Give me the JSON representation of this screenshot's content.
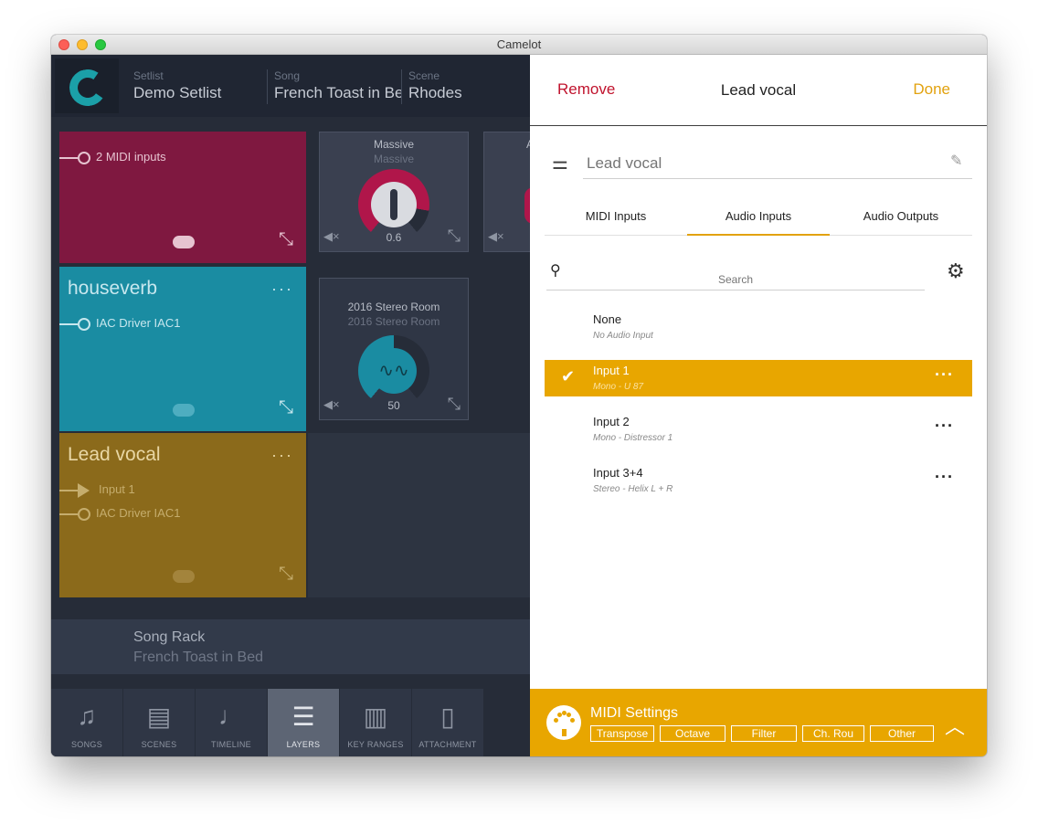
{
  "window": {
    "title": "Camelot"
  },
  "header": {
    "setlist_label": "Setlist",
    "setlist_value": "Demo Setlist",
    "song_label": "Song",
    "song_value": "French Toast in Be",
    "scene_label": "Scene",
    "scene_value": "Rhodes"
  },
  "tiles": {
    "pink": {
      "row1": "2 MIDI inputs"
    },
    "teal": {
      "name": "houseverb",
      "dots": "···",
      "row1": "IAC Driver IAC1"
    },
    "gold": {
      "name": "Lead vocal",
      "dots": "···",
      "row1": "Input 1",
      "row2": "IAC Driver IAC1"
    }
  },
  "plugins": {
    "massive": {
      "title": "Massive",
      "subtitle": "Massive",
      "value": "0.6"
    },
    "stereo_room": {
      "title": "2016 Stereo Room",
      "subtitle": "2016 Stereo Room",
      "value": "50"
    },
    "partial_a": {
      "title": "A"
    }
  },
  "song_rack": {
    "title": "Song Rack",
    "subtitle": "French Toast in Bed"
  },
  "tabs": [
    {
      "label": "SONGS",
      "icon": "music-note-icon"
    },
    {
      "label": "SCENES",
      "icon": "clapperboard-icon"
    },
    {
      "label": "TIMELINE",
      "icon": "timeline-icon"
    },
    {
      "label": "LAYERS",
      "icon": "sliders-icon"
    },
    {
      "label": "KEY RANGES",
      "icon": "piano-icon"
    },
    {
      "label": "ATTACHMENT",
      "icon": "document-icon"
    }
  ],
  "panel": {
    "remove": "Remove",
    "title": "Lead vocal",
    "done": "Done",
    "name_placeholder": "Lead vocal",
    "tabs": [
      "MIDI Inputs",
      "Audio Inputs",
      "Audio Outputs"
    ],
    "search_placeholder": "Search",
    "items": [
      {
        "title": "None",
        "subtitle": "No Audio Input"
      },
      {
        "title": "Input 1",
        "subtitle": "Mono - U 87"
      },
      {
        "title": "Input 2",
        "subtitle": "Mono - Distressor 1"
      },
      {
        "title": "Input 3+4",
        "subtitle": "Stereo - Helix L + R"
      }
    ],
    "midi_settings": {
      "title": "MIDI Settings",
      "buttons": [
        "Transpose",
        "Octave",
        "Filter",
        "Ch. Rou",
        "Other"
      ]
    }
  },
  "colors": {
    "accent": "#e8a600",
    "remove": "#c0132d",
    "pink_tile": "#7f1840",
    "teal_tile": "#1a8ca2",
    "gold_tile": "#8b6a1b"
  }
}
